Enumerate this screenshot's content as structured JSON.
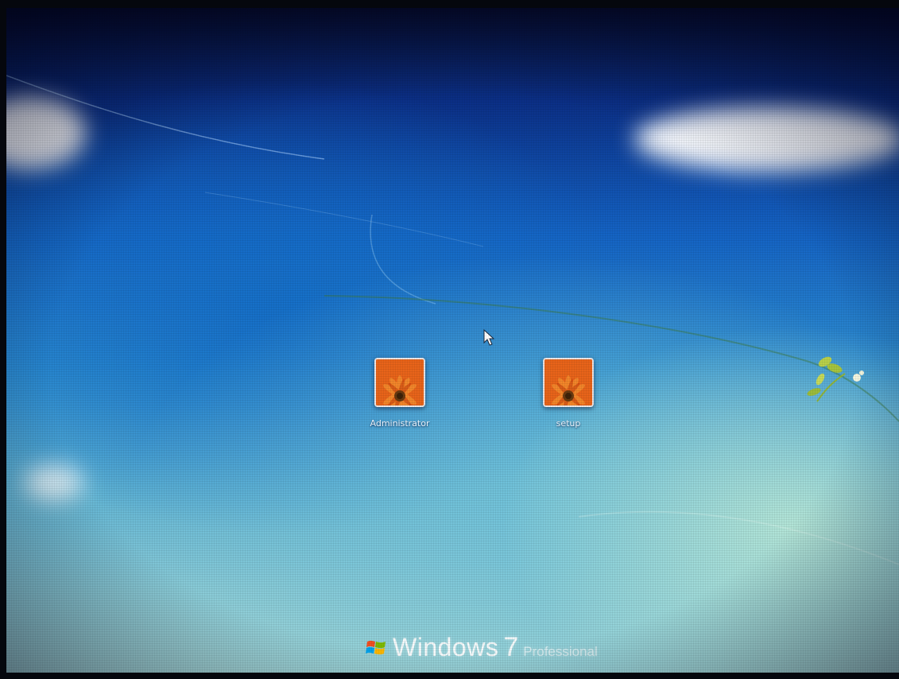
{
  "login_screen": {
    "users": [
      {
        "name": "Administrator"
      },
      {
        "name": "setup"
      }
    ]
  },
  "branding": {
    "product": "Windows",
    "version": "7",
    "edition": "Professional"
  },
  "icons": {
    "avatar": "orange-flower-avatar-icon",
    "logo": "windows-flag-icon",
    "cursor": "mouse-pointer-icon"
  },
  "colors": {
    "accent_blue": "#1463c4",
    "avatar_orange": "#e25a10"
  }
}
